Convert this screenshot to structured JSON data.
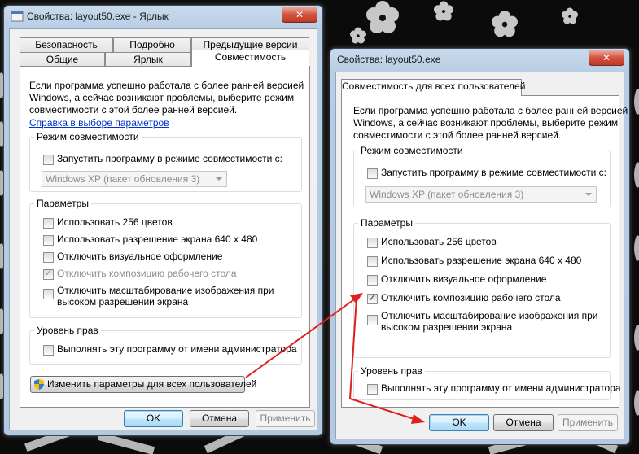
{
  "left_window": {
    "title": "Свойства: layout50.exe - Ярлык",
    "close_glyph": "✕",
    "tabs_back": [
      "Безопасность",
      "Подробно",
      "Предыдущие версии"
    ],
    "tabs_front": [
      "Общие",
      "Ярлык",
      "Совместимость"
    ],
    "active_tab": "Совместимость",
    "intro": [
      "Если программа успешно работала с более ранней версией",
      "Windows, а сейчас возникают проблемы, выберите режим",
      "совместимости с этой более ранней версией."
    ],
    "help_link": "Справка в выборе параметров",
    "compat_group": "Режим совместимости",
    "compat_checkbox": "Запустить программу в режиме совместимости с:",
    "compat_select": "Windows XP (пакет обновления 3)",
    "params_group": "Параметры",
    "params": [
      {
        "label": "Использовать 256 цветов",
        "state": "unchecked"
      },
      {
        "label": "Использовать разрешение экрана 640 x 480",
        "state": "unchecked"
      },
      {
        "label": "Отключить визуальное оформление",
        "state": "unchecked"
      },
      {
        "label": "Отключить композицию рабочего стола",
        "state": "checked-disabled"
      },
      {
        "label": "Отключить масштабирование изображения при",
        "label2": "высоком разрешении экрана",
        "state": "unchecked"
      }
    ],
    "rights_group": "Уровень прав",
    "admin_checkbox": "Выполнять эту программу от имени администратора",
    "all_users_button": "Изменить параметры для всех пользователей",
    "ok": "OK",
    "cancel": "Отмена",
    "apply": "Применить"
  },
  "right_window": {
    "title": "Свойства: layout50.exe",
    "close_glyph": "✕",
    "tab": "Совместимость для всех пользователей",
    "intro": [
      "Если программа успешно работала с более ранней версией",
      "Windows, а сейчас возникают проблемы, выберите режим",
      "совместимости с этой более ранней версией."
    ],
    "compat_group": "Режим совместимости",
    "compat_checkbox": "Запустить программу в режиме совместимости с:",
    "compat_select": "Windows XP (пакет обновления 3)",
    "params_group": "Параметры",
    "params": [
      {
        "label": "Использовать 256 цветов",
        "state": "unchecked"
      },
      {
        "label": "Использовать разрешение экрана 640 x 480",
        "state": "unchecked"
      },
      {
        "label": "Отключить визуальное оформление",
        "state": "unchecked"
      },
      {
        "label": "Отключить композицию рабочего стола",
        "state": "checked"
      },
      {
        "label": "Отключить масштабирование изображения при",
        "label2": "высоком разрешении экрана",
        "state": "unchecked"
      }
    ],
    "rights_group": "Уровень прав",
    "admin_checkbox": "Выполнять эту программу от имени администратора",
    "ok": "OK",
    "cancel": "Отмена",
    "apply": "Применить"
  },
  "colors": {
    "annotation_arrow": "#e0201c",
    "desktop": "#0b0b0b"
  }
}
